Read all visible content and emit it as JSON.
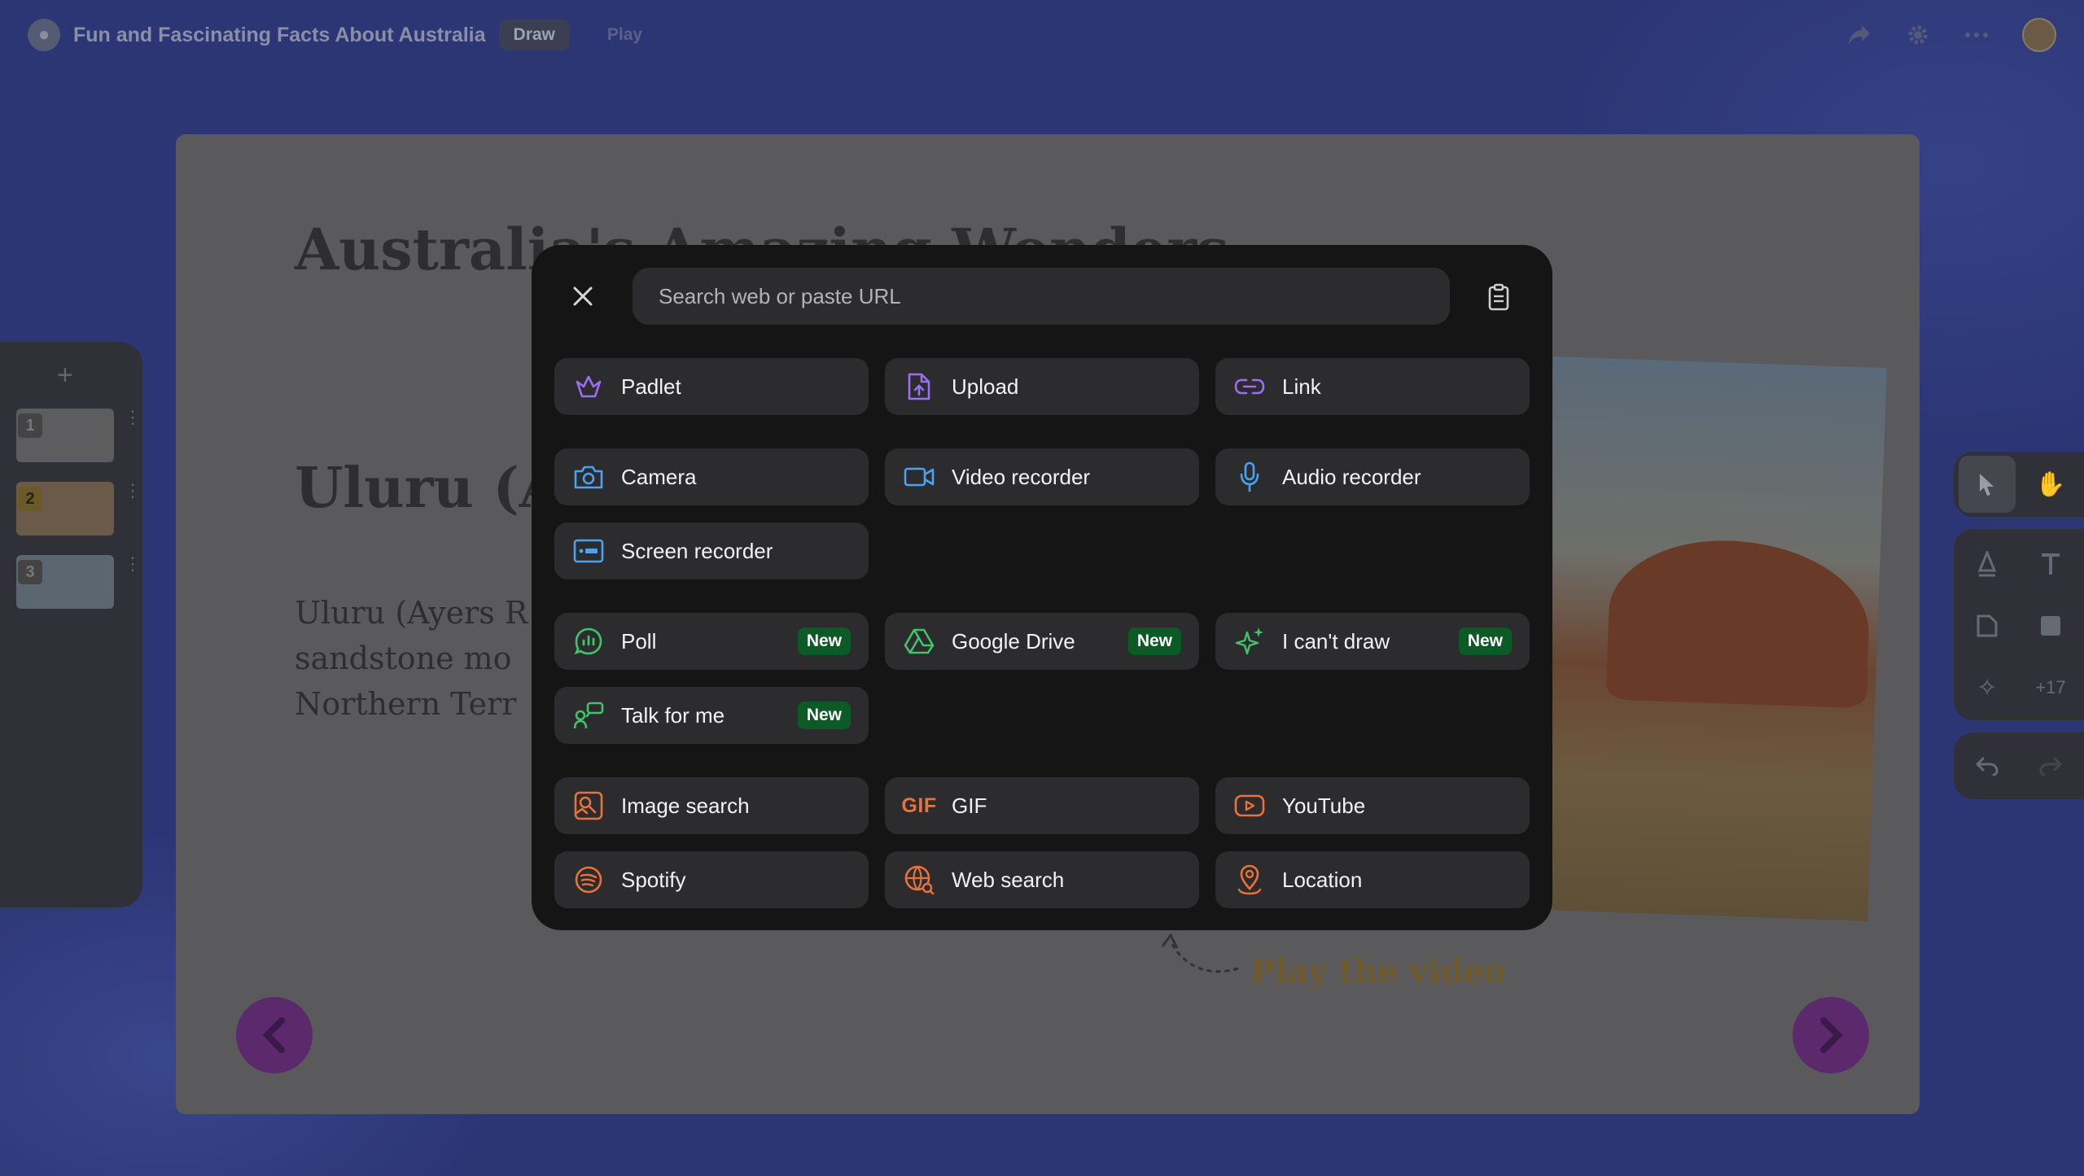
{
  "app": {
    "doc_title": "Fun and Fascinating Facts About Australia",
    "tabs": [
      {
        "label": "Draw",
        "active": true
      },
      {
        "label": "Play",
        "active": false
      }
    ]
  },
  "slide": {
    "title": "Australia's Amazing Wonders",
    "heading": "Uluru (Ayers Rock)",
    "body_lines": [
      "Uluru (Ayers R",
      "sandstone mo",
      "Northern Terr"
    ],
    "play_hint": "Play the video"
  },
  "thumbnails": {
    "add_label": "+",
    "items": [
      {
        "num": "1"
      },
      {
        "num": "2"
      },
      {
        "num": "3"
      }
    ]
  },
  "toolbar": {
    "more_count": "+17"
  },
  "modal": {
    "search_placeholder": "Search web or paste URL",
    "new_badge": "New",
    "options": [
      {
        "label": "Padlet",
        "icon": "padlet-icon"
      },
      {
        "label": "Upload",
        "icon": "upload-icon"
      },
      {
        "label": "Link",
        "icon": "link-icon"
      },
      {
        "label": "Camera",
        "icon": "camera-icon"
      },
      {
        "label": "Video recorder",
        "icon": "video-recorder-icon"
      },
      {
        "label": "Audio recorder",
        "icon": "microphone-icon"
      },
      {
        "label": "Screen recorder",
        "icon": "screen-recorder-icon"
      },
      {
        "label": "Poll",
        "icon": "poll-icon",
        "new": true
      },
      {
        "label": "Google Drive",
        "icon": "google-drive-icon",
        "new": true
      },
      {
        "label": "I can't draw",
        "icon": "sparkle-icon",
        "new": true
      },
      {
        "label": "Talk for me",
        "icon": "talk-icon",
        "new": true
      },
      {
        "label": "Image search",
        "icon": "image-search-icon"
      },
      {
        "label": "GIF",
        "icon": "gif-icon",
        "icon_text": "GIF"
      },
      {
        "label": "YouTube",
        "icon": "youtube-icon"
      },
      {
        "label": "Spotify",
        "icon": "spotify-icon"
      },
      {
        "label": "Web search",
        "icon": "web-search-icon"
      },
      {
        "label": "Location",
        "icon": "location-icon"
      }
    ]
  },
  "colors": {
    "purple": "#9b6ef3",
    "blue": "#4aa3f0",
    "green": "#3fc46a",
    "orange": "#e8733a",
    "badge_green": "#0c5a26"
  }
}
